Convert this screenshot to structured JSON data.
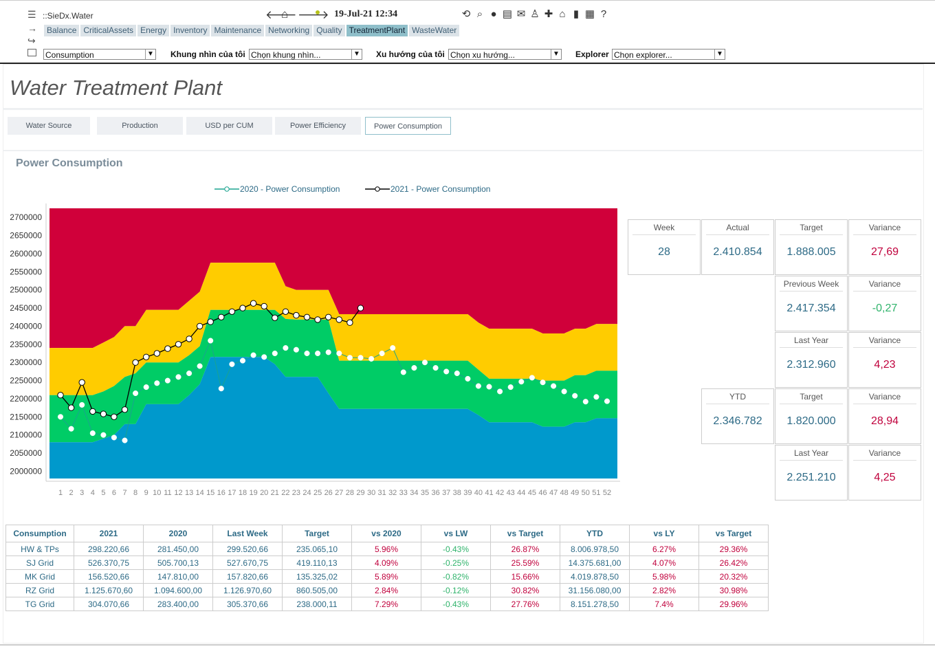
{
  "window_title": "::SieDx.Water",
  "datetime": "19-Jul-21 12:34",
  "tabs": [
    "Balance",
    "CriticalAssets",
    "Energy",
    "Inventory",
    "Maintenance",
    "Networking",
    "Quality",
    "TreatmentPlant",
    "WasteWater"
  ],
  "active_tab": "TreatmentPlant",
  "toolbar_icons": [
    "refresh-icon",
    "search-report-icon",
    "location-icon",
    "print-icon",
    "mail-icon",
    "user-icon",
    "add-icon",
    "home-chart-icon",
    "bar-chart-icon",
    "grid-icon",
    "help-icon"
  ],
  "filters": {
    "first_select": "Consumption",
    "view_label": "Khung nhìn của tôi",
    "view_value": "Chọn khung nhìn...",
    "trend_label": "Xu hướng của tôi",
    "trend_value": "Chọn xu hướng...",
    "explorer_label": "Explorer",
    "explorer_value": "Chọn explorer..."
  },
  "page_title": "Water Treatment Plant",
  "buttons": [
    "Water Source",
    "Production",
    "USD per CUM",
    "Power Efficiency",
    "Power Consumption"
  ],
  "active_button": "Power Consumption",
  "section_title": "Power Consumption",
  "colors": {
    "band_red": "#d0003a",
    "band_yellow": "#ffcc00",
    "band_green": "#00cc66",
    "band_blue": "#0099cc",
    "series_2020": "#1aa38f",
    "series_2021": "#000000"
  },
  "chart_data": {
    "type": "line",
    "xlabel": "",
    "ylabel": "",
    "x": [
      1,
      2,
      3,
      4,
      5,
      6,
      7,
      8,
      9,
      10,
      11,
      12,
      13,
      14,
      15,
      16,
      17,
      18,
      19,
      20,
      21,
      22,
      23,
      24,
      25,
      26,
      27,
      28,
      29,
      30,
      31,
      32,
      33,
      34,
      35,
      36,
      37,
      38,
      39,
      40,
      41,
      42,
      43,
      44,
      45,
      46,
      47,
      48,
      49,
      50,
      51,
      52
    ],
    "ylim": [
      1980000,
      2720000
    ],
    "yticks": [
      2000000,
      2050000,
      2100000,
      2150000,
      2200000,
      2250000,
      2300000,
      2350000,
      2400000,
      2450000,
      2500000,
      2550000,
      2600000,
      2650000,
      2700000
    ],
    "bands": {
      "blue_top": [
        2080000,
        2080000,
        2080000,
        2080000,
        2090000,
        2100000,
        2130000,
        2130000,
        2185000,
        2185000,
        2185000,
        2185000,
        2210000,
        2240000,
        2315000,
        2315000,
        2315000,
        2315000,
        2315000,
        2315000,
        2295000,
        2260000,
        2260000,
        2260000,
        2260000,
        2215000,
        2172000,
        2172000,
        2172000,
        2172000,
        2172000,
        2172000,
        2172000,
        2172000,
        2172000,
        2172000,
        2172000,
        2172000,
        2172000,
        2155000,
        2135000,
        2135000,
        2135000,
        2135000,
        2135000,
        2123000,
        2123000,
        2123000,
        2135000,
        2135000,
        2146000,
        2146000
      ],
      "green_top": [
        2210000,
        2210000,
        2210000,
        2210000,
        2220000,
        2235000,
        2260000,
        2270000,
        2300000,
        2300000,
        2300000,
        2300000,
        2320000,
        2345000,
        2445000,
        2445000,
        2445000,
        2445000,
        2445000,
        2445000,
        2445000,
        2420000,
        2418000,
        2418000,
        2418000,
        2418000,
        2305000,
        2305000,
        2305000,
        2305000,
        2305000,
        2305000,
        2305000,
        2305000,
        2305000,
        2305000,
        2305000,
        2305000,
        2305000,
        2280000,
        2255000,
        2255000,
        2255000,
        2255000,
        2255000,
        2250000,
        2250000,
        2250000,
        2265000,
        2265000,
        2277000,
        2277000
      ],
      "yellow_top": [
        2340000,
        2340000,
        2340000,
        2340000,
        2355000,
        2370000,
        2400000,
        2400000,
        2445000,
        2445000,
        2445000,
        2445000,
        2470000,
        2495000,
        2575000,
        2575000,
        2575000,
        2575000,
        2575000,
        2575000,
        2575000,
        2510000,
        2500000,
        2500000,
        2500000,
        2500000,
        2433000,
        2433000,
        2433000,
        2433000,
        2433000,
        2433000,
        2433000,
        2433000,
        2433000,
        2433000,
        2433000,
        2433000,
        2433000,
        2410000,
        2393000,
        2393000,
        2393000,
        2393000,
        2393000,
        2380000,
        2380000,
        2380000,
        2393000,
        2393000,
        2406000,
        2406000
      ],
      "red_top": 2725000
    },
    "series": [
      {
        "name": "2020 - Power Consumption",
        "values": [
          2150000,
          2117000,
          2183000,
          2105000,
          2100000,
          2093000,
          2085000,
          2215000,
          2232000,
          2243000,
          2250000,
          2260000,
          2270000,
          2290000,
          2360000,
          2228000,
          2295000,
          2305000,
          2320000,
          2315000,
          2325000,
          2340000,
          2335000,
          2325000,
          2325000,
          2328000,
          2325000,
          2313000,
          2313000,
          2310000,
          2325000,
          2340000,
          2273000,
          2285000,
          2300000,
          2285000,
          2275000,
          2270000,
          2255000,
          2235000,
          2233000,
          2220000,
          2232000,
          2247000,
          2258000,
          2245000,
          2235000,
          2220000,
          2208000,
          2192000,
          2205000,
          2193000
        ]
      },
      {
        "name": "2021 - Power Consumption",
        "values": [
          2210000,
          2175000,
          2245000,
          2165000,
          2158000,
          2150000,
          2170000,
          2300000,
          2315000,
          2325000,
          2338000,
          2350000,
          2365000,
          2400000,
          2412000,
          2425000,
          2440000,
          2450000,
          2463000,
          2455000,
          2423000,
          2440000,
          2430000,
          2425000,
          2418000,
          2425000,
          2418000,
          2410000,
          2450000
        ]
      }
    ]
  },
  "kpis": [
    {
      "h": "Week",
      "v": "28",
      "tone": "blue"
    },
    {
      "h": "Actual",
      "v": "2.410.854",
      "tone": "blue"
    },
    {
      "h": "Target",
      "v": "1.888.005",
      "tone": "blue"
    },
    {
      "h": "Variance",
      "v": "27,69",
      "tone": "red"
    },
    {
      "h": "Previous Week",
      "v": "2.417.354",
      "tone": "blue"
    },
    {
      "h": "Variance",
      "v": "-0,27",
      "tone": "green"
    },
    {
      "h": "Last Year",
      "v": "2.312.960",
      "tone": "blue"
    },
    {
      "h": "Variance",
      "v": "4,23",
      "tone": "red"
    },
    {
      "h": "YTD",
      "v": "2.346.782",
      "tone": "blue"
    },
    {
      "h": "Target",
      "v": "1.820.000",
      "tone": "blue"
    },
    {
      "h": "Variance",
      "v": "28,94",
      "tone": "red"
    },
    {
      "h": "Last Year",
      "v": "2.251.210",
      "tone": "blue"
    },
    {
      "h": "Variance",
      "v": "4,25",
      "tone": "red"
    }
  ],
  "table": {
    "headers": [
      "Consumption",
      "2021",
      "2020",
      "Last Week",
      "Target",
      "vs 2020",
      "vs LW",
      "vs Target",
      "YTD",
      "vs LY",
      "vs Target"
    ],
    "rows": [
      [
        "HW & TPs",
        "298.220,66",
        "281.450,00",
        "299.520,66",
        "235.065,10",
        "5.96%",
        "-0.43%",
        "26.87%",
        "8.006.978,50",
        "6.27%",
        "29.36%"
      ],
      [
        "SJ Grid",
        "526.370,75",
        "505.700,13",
        "527.670,75",
        "419.110,13",
        "4.09%",
        "-0.25%",
        "25.59%",
        "14.375.681,00",
        "4.07%",
        "26.42%"
      ],
      [
        "MK Grid",
        "156.520,66",
        "147.810,00",
        "157.820,66",
        "135.325,02",
        "5.89%",
        "-0.82%",
        "15.66%",
        "4.019.878,50",
        "5.98%",
        "20.32%"
      ],
      [
        "RZ Grid",
        "1.125.670,60",
        "1.094.600,00",
        "1.126.970,60",
        "860.505,00",
        "2.84%",
        "-0.12%",
        "30.82%",
        "31.156.080,00",
        "2.82%",
        "30.98%"
      ],
      [
        "TG Grid",
        "304.070,66",
        "283.400,00",
        "305.370,66",
        "238.000,11",
        "7.29%",
        "-0.43%",
        "27.76%",
        "8.151.278,50",
        "7.4%",
        "29.96%"
      ]
    ]
  }
}
